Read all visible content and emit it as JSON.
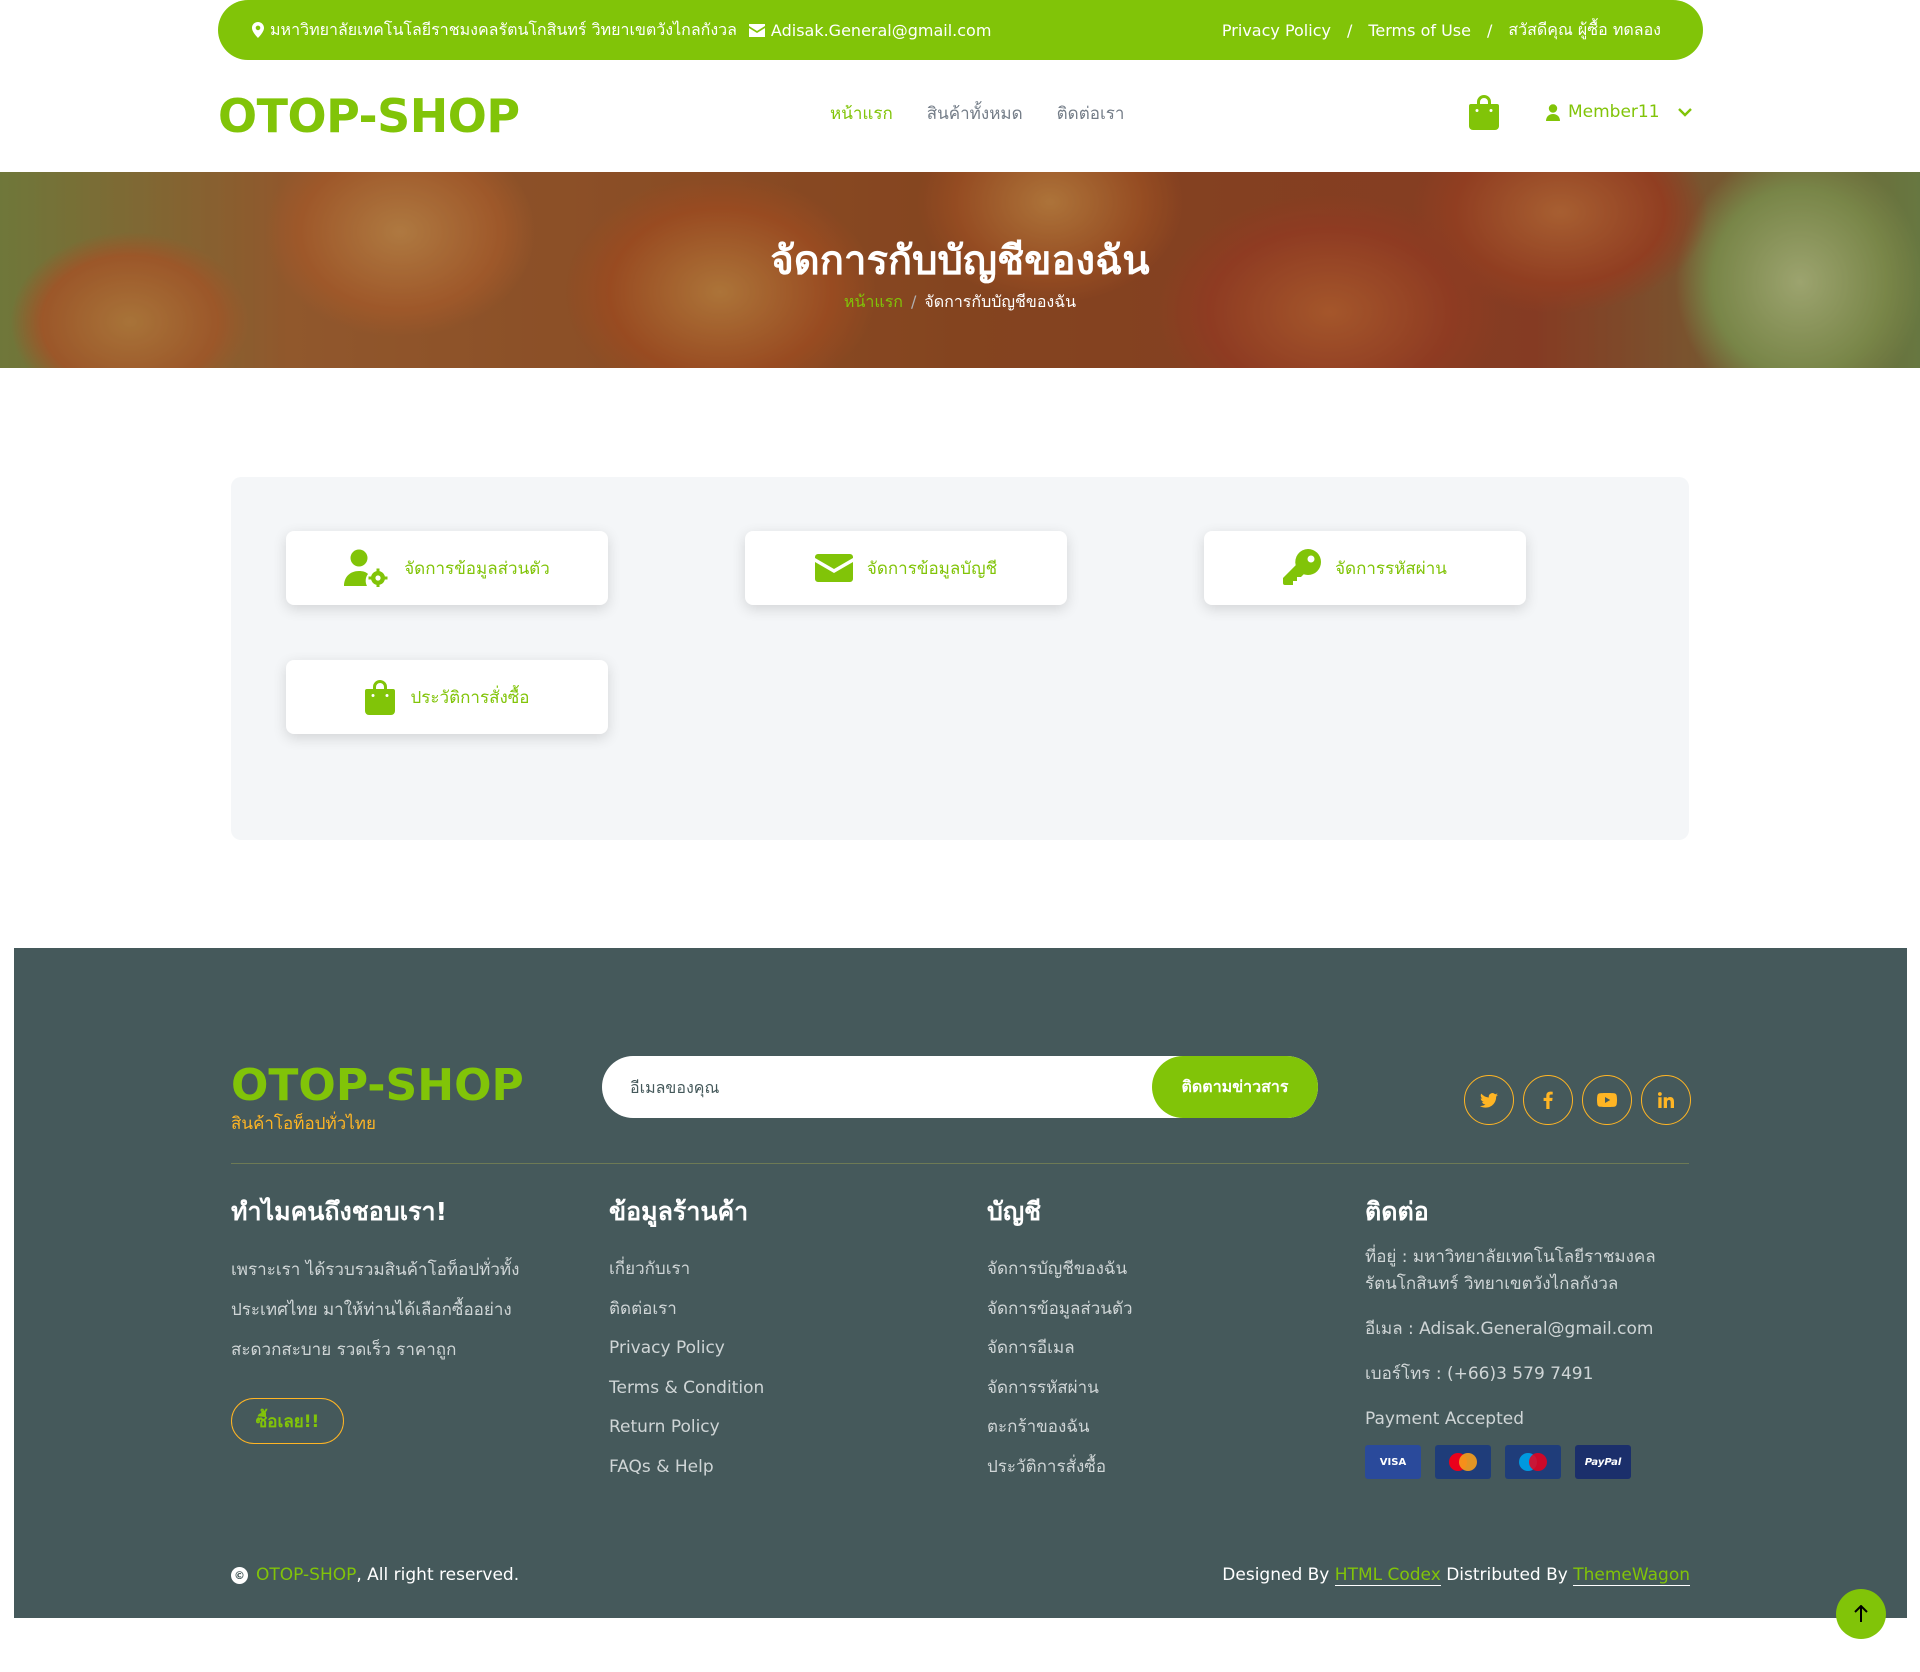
{
  "topbar": {
    "address": "มหาวิทยาลัยเทคโนโลยีราชมงคลรัตนโกสินทร์ วิทยาเขตวังไกลกังวล",
    "email": "Adisak.General@gmail.com",
    "privacy": "Privacy Policy",
    "terms": "Terms of Use",
    "greeting": "สวัสดีคุณ ผู้ซื้อ ทดลอง",
    "separator": "/"
  },
  "navbar": {
    "brand": "OTOP-SHOP",
    "links": [
      "หน้าแรก",
      "สินค้าทั้งหมด",
      "ติดต่อเรา"
    ],
    "member": "Member11"
  },
  "hero": {
    "title": "จัดการกับบัญชีของฉัน",
    "breadcrumb_home": "หน้าแรก",
    "breadcrumb_sep": "/",
    "breadcrumb_current": "จัดการกับบัญชีของฉัน"
  },
  "account_menu": [
    {
      "label": "จัดการข้อมูลส่วนตัว",
      "icon": "user-gear-icon"
    },
    {
      "label": "จัดการข้อมูลบัญชี",
      "icon": "envelope-icon"
    },
    {
      "label": "จัดการรหัสผ่าน",
      "icon": "key-icon"
    },
    {
      "label": "ประวัติการสั่งซื้อ",
      "icon": "shopping-bag-icon"
    }
  ],
  "footer": {
    "brand": "OTOP-SHOP",
    "tagline": "สินค้าโอท็อปทั่วไทย",
    "newsletter_placeholder": "อีเมลของคุณ",
    "newsletter_button": "ติดตามข่าวสาร",
    "why": {
      "title": "ทำไมคนถึงชอบเรา!",
      "lines": [
        "เพราะเรา ได้รวบรวมสินค้าโอท็อปทั่วทั้ง",
        "ประเทศไทย มาให้ท่านได้เลือกซื้ออย่าง",
        "สะดวกสะบาย รวดเร็ว ราคาถูก"
      ],
      "button": "ซื้อเลย!!"
    },
    "shop": {
      "title": "ข้อมูลร้านค้า",
      "links": [
        "เกี่ยวกับเรา",
        "ติดต่อเรา",
        "Privacy Policy",
        "Terms & Condition",
        "Return Policy",
        "FAQs & Help"
      ]
    },
    "account": {
      "title": "บัญชี",
      "links": [
        "จัดการบัญชีของฉัน",
        "จัดการข้อมูลส่วนตัว",
        "จัดการอีเมล",
        "จัดการรหัสผ่าน",
        "ตะกร้าของฉัน",
        "ประวัติการสั่งซื้อ"
      ]
    },
    "contact": {
      "title": "ติดต่อ",
      "address": "ที่อยู่ : มหาวิทยาลัยเทคโนโลยีราชมงคล รัตนโกสินทร์ วิทยาเขตวังไกลกังวล",
      "email": "อีเมล : Adisak.General@gmail.com",
      "phone": "เบอร์โทร : (+66)3 579 7491",
      "payment_label": "Payment Accepted",
      "payment_methods": [
        "VISA",
        "",
        "",
        "PayPal"
      ]
    },
    "copyright_brand": "OTOP-SHOP",
    "copyright_rest": ", All right reserved.",
    "designed_by": "Designed By",
    "designer": "HTML Codex",
    "distributed_by": "Distributed By",
    "distributor": "ThemeWagon"
  },
  "colors": {
    "primary": "#81c408",
    "secondary": "#ffb524",
    "footer_bg": "#45595b"
  }
}
